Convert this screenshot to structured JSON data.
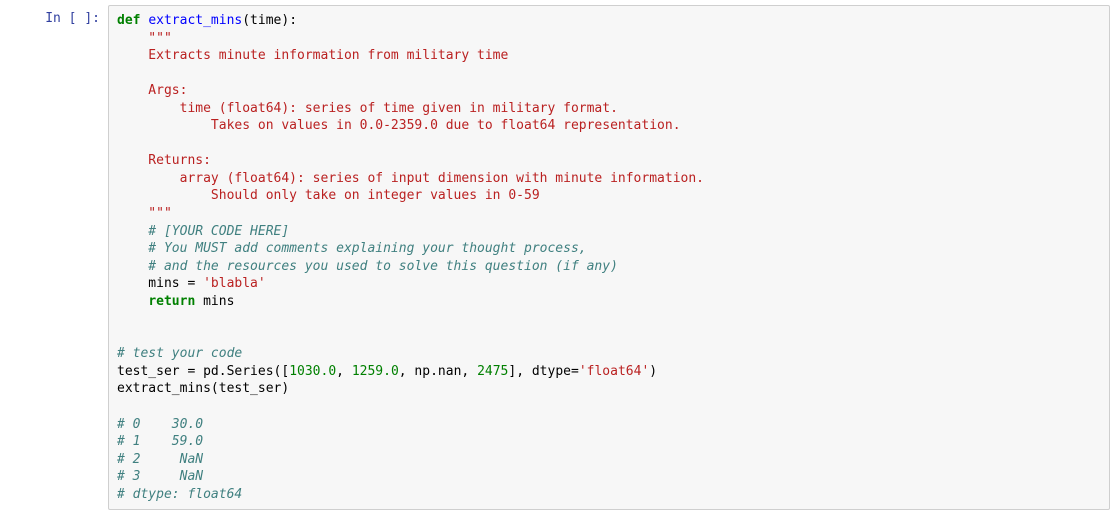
{
  "prompt": "In [ ]:",
  "code": {
    "l0": {
      "kw1": "def",
      "sp": " ",
      "fn": "extract_mins",
      "sig": "(time):"
    },
    "l1": "    \"\"\"",
    "l2": "    Extracts minute information from military time",
    "l3": "",
    "l4": "    Args:",
    "l5": "        time (float64): series of time given in military format.",
    "l6": "            Takes on values in 0.0-2359.0 due to float64 representation.",
    "l7": "",
    "l8": "    Returns:",
    "l9": "        array (float64): series of input dimension with minute information.",
    "l10": "            Should only take on integer values in 0-59",
    "l11": "    \"\"\"",
    "l12": "    # [YOUR CODE HERE]",
    "l13": "    # You MUST add comments explaining your thought process,",
    "l14": "    # and the resources you used to solve this question (if any)",
    "l15": {
      "pre": "    mins = ",
      "str": "'blabla'"
    },
    "l16": {
      "pre": "    ",
      "kw": "return",
      "post": " mins"
    },
    "l17": "",
    "l18": "",
    "l19": "# test your code",
    "l20": {
      "a": "test_ser = pd.Series([",
      "n1": "1030.0",
      "c1": ", ",
      "n2": "1259.0",
      "c2": ", np.nan, ",
      "n3": "2475",
      "c3": "], dtype=",
      "s": "'float64'",
      "e": ")"
    },
    "l21": "extract_mins(test_ser)",
    "l22": "",
    "l23": "# 0    30.0",
    "l24": "# 1    59.0",
    "l25": "# 2     NaN",
    "l26": "# 3     NaN",
    "l27": "# dtype: float64"
  }
}
